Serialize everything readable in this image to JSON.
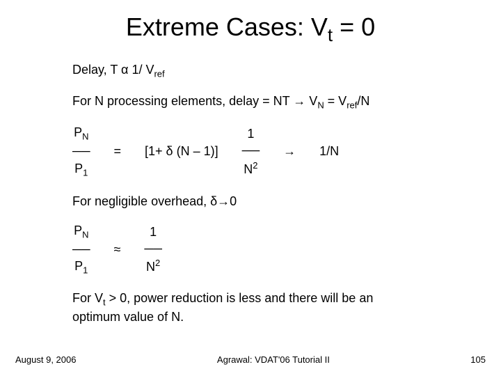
{
  "title_main": "Extreme Cases: V",
  "title_sub": "t",
  "title_tail": " = 0",
  "line1_a": "Delay, T α  1/ V",
  "line1_sub": "ref",
  "line2_a": "For N processing elements, delay = NT  →  V",
  "line2_sub1": "N",
  "line2_b": " = V",
  "line2_sub2": "ref",
  "line2_c": "/N",
  "frac1_num_a": "P",
  "frac1_num_sub": "N",
  "frac1_bar": "──",
  "frac1_den_a": "P",
  "frac1_den_sub": "1",
  "eq_sign": "=",
  "term_mid": "[1+ δ (N – 1)]",
  "frac2_num": "1",
  "frac2_bar": "──",
  "frac2_den_a": "N",
  "frac2_den_sup": "2",
  "arrow": "→",
  "term_end": "1/N",
  "line3": "For negligible overhead, δ→0",
  "approx_sign": "≈",
  "line4_a": "For V",
  "line4_sub": "t",
  "line4_b": " > 0, power reduction is less and there will be an",
  "line4_c": " optimum value of N.",
  "footer_left": "August 9, 2006",
  "footer_center": "Agrawal: VDAT'06 Tutorial II",
  "footer_right": "105"
}
